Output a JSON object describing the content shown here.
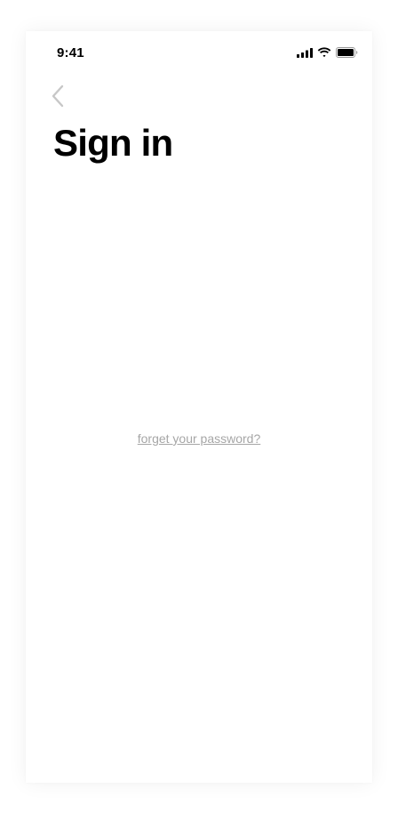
{
  "status_bar": {
    "time": "9:41",
    "icons": [
      "signal-icon",
      "wifi-icon",
      "battery-icon"
    ]
  },
  "nav": {
    "back_icon": "chevron-left-icon"
  },
  "page": {
    "title": "Sign in",
    "forgot_password_link": "forget your password?"
  },
  "colors": {
    "title": "#000000",
    "link": "#a6a6a6",
    "back_chevron": "#c7c7c7",
    "background": "#ffffff"
  }
}
